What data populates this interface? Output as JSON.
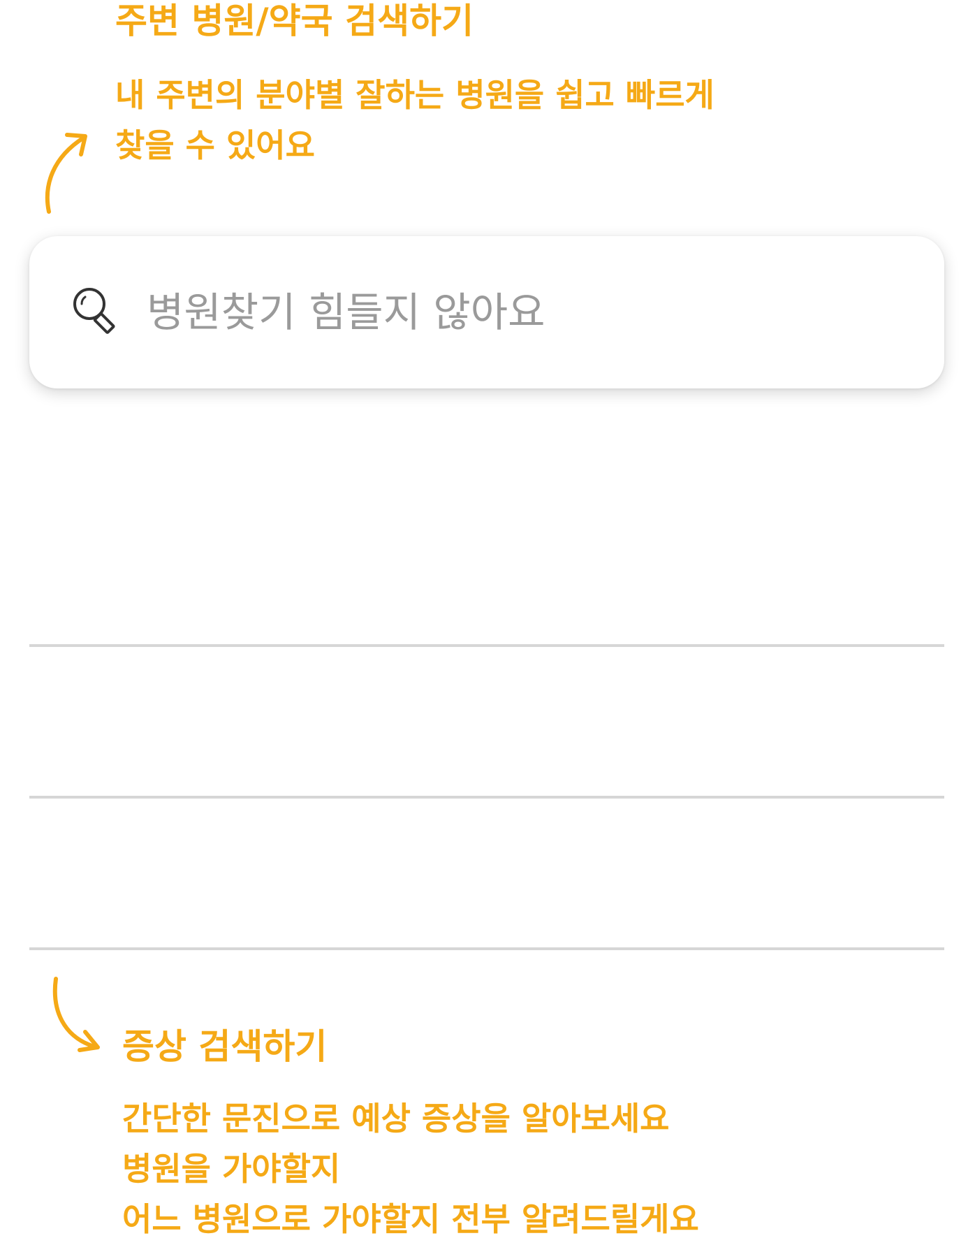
{
  "top_annotation": {
    "title": "주변 병원/약국 검색하기",
    "lines": [
      "내 주변의 분야별 잘하는 병원을 쉽고 빠르게",
      "찾을 수 있어요"
    ]
  },
  "search": {
    "icon": "search-icon",
    "placeholder": "병원찾기 힘들지 않아요"
  },
  "bottom_annotation": {
    "title": "증상 검색하기",
    "lines": [
      "간단한 문진으로 예상 증상을 알아보세요",
      "병원을 가야할지",
      "어느 병원으로 가야할지 전부 알려드릴게요"
    ]
  },
  "colors": {
    "accent": "#F5A916",
    "divider": "#D6D6D6",
    "placeholder": "#9A9A9A",
    "background": "#FFFFFF"
  }
}
